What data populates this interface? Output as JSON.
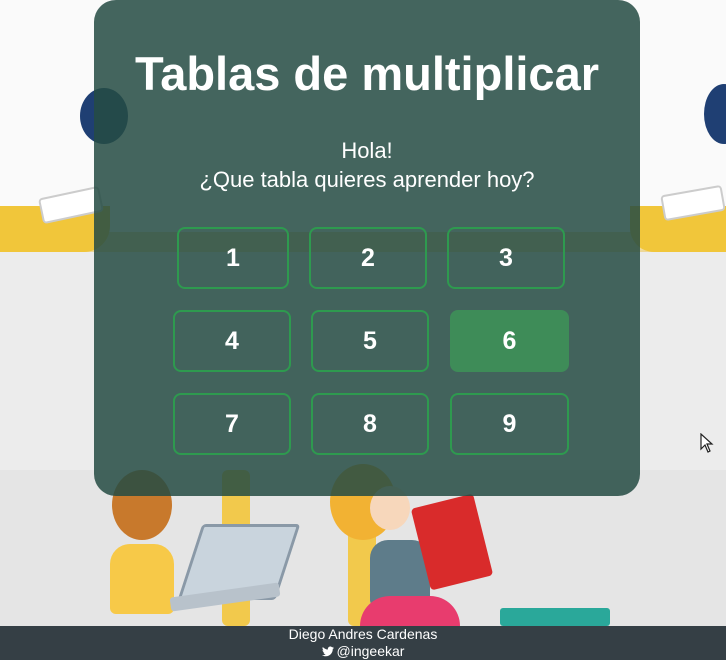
{
  "title": "Tablas de multiplicar",
  "greeting": {
    "line1": "Hola!",
    "line2": "¿Que tabla quieres aprender hoy?"
  },
  "tables": [
    "1",
    "2",
    "3",
    "4",
    "5",
    "6",
    "7",
    "8",
    "9"
  ],
  "selected_table": "6",
  "footer": {
    "author": "Diego Andres Cardenas",
    "handle": "@ingeekar",
    "icon": "twitter-icon"
  },
  "colors": {
    "panel": "#254c44",
    "button_border": "#2e9a4f",
    "button_active": "#3e8c58",
    "footer": "#353f45",
    "text": "#ffffff"
  }
}
